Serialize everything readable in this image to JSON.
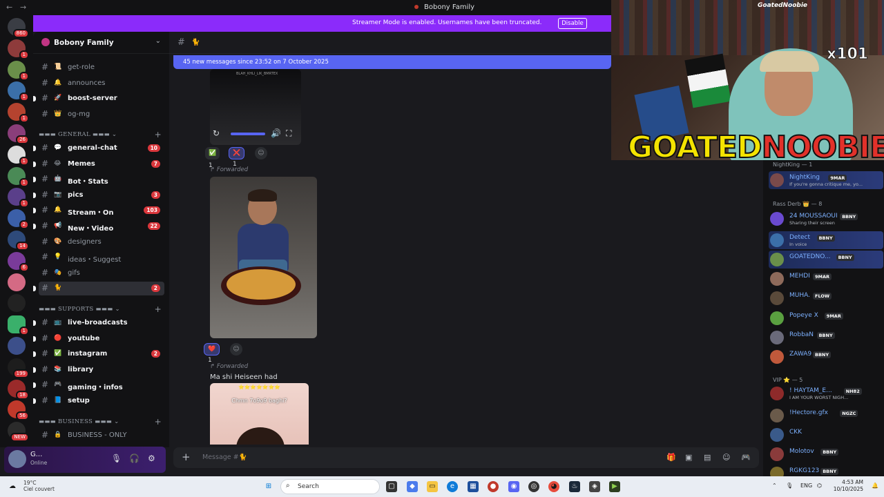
{
  "titlebar": {
    "title": "Bobony Family",
    "back": "←",
    "forward": "→"
  },
  "banner": {
    "text": "Streamer Mode is enabled. Usernames have been truncated.",
    "button": "Disable"
  },
  "guilds": [
    {
      "badge": "860"
    },
    {
      "badge": "1"
    },
    {
      "badge": "1"
    },
    {
      "badge": "1"
    },
    {
      "badge": "1"
    },
    {
      "badge": "26"
    },
    {
      "badge": "1"
    },
    {
      "badge": "1"
    },
    {
      "badge": "1"
    },
    {
      "badge": "2"
    },
    {
      "badge": "14"
    },
    {
      "badge": "6"
    },
    {
      "badge": ""
    },
    {
      "badge": ""
    },
    {
      "badge": "1"
    },
    {
      "badge": ""
    },
    {
      "badge": "199"
    },
    {
      "badge": "18"
    },
    {
      "badge": "56"
    },
    {
      "badge": "NEW"
    }
  ],
  "server": {
    "name": "Bobony Family"
  },
  "channels": [
    {
      "emoji": "📜",
      "label": "get-role",
      "unread": false,
      "count": ""
    },
    {
      "emoji": "🔔",
      "label": "announces",
      "unread": false,
      "count": ""
    },
    {
      "emoji": "🚀",
      "label": "boost-server",
      "unread": true,
      "count": ""
    },
    {
      "emoji": "👑",
      "label": "og-mg",
      "unread": false,
      "count": ""
    }
  ],
  "categories": {
    "general": "GENERAL",
    "supports": "SUPPORTS",
    "business": "BUSINESS"
  },
  "general_channels": [
    {
      "emoji": "💬",
      "label": "general-chat",
      "unread": true,
      "count": "10"
    },
    {
      "emoji": "😂",
      "label": "Memes",
      "unread": true,
      "count": "7"
    },
    {
      "emoji": "🤖",
      "label": "Bot・Stats",
      "unread": true,
      "count": ""
    },
    {
      "emoji": "📷",
      "label": "pics",
      "unread": true,
      "count": "3"
    },
    {
      "emoji": "🔔",
      "label": "Stream・On",
      "unread": true,
      "count": "103"
    },
    {
      "emoji": "📢",
      "label": "New・Video",
      "unread": true,
      "count": "22"
    },
    {
      "emoji": "🎨",
      "label": "designers",
      "unread": false,
      "count": ""
    },
    {
      "emoji": "💡",
      "label": "ideas・Suggest",
      "unread": false,
      "count": ""
    },
    {
      "emoji": "🎭",
      "label": "gifs",
      "unread": false,
      "count": ""
    },
    {
      "emoji": "🐈",
      "label": "",
      "unread": true,
      "count": "2"
    }
  ],
  "support_channels": [
    {
      "emoji": "📺",
      "label": "live-broadcasts",
      "unread": true,
      "count": ""
    },
    {
      "emoji": "🔴",
      "label": "youtube",
      "unread": true,
      "count": ""
    },
    {
      "emoji": "✅",
      "label": "instagram",
      "unread": true,
      "count": "2"
    },
    {
      "emoji": "📚",
      "label": "library",
      "unread": true,
      "count": ""
    },
    {
      "emoji": "🎮",
      "label": "gaming・infos",
      "unread": true,
      "count": ""
    },
    {
      "emoji": "📘",
      "label": "setup",
      "unread": true,
      "count": ""
    }
  ],
  "business_channels": [
    {
      "emoji": "🔒",
      "label": "BUSINESS - ONLY",
      "unread": false,
      "count": ""
    }
  ],
  "user": {
    "name": "G...",
    "status": "Online"
  },
  "channel_header": {
    "emoji": "🐈"
  },
  "new_messages": "45 new messages since 23:52 on 7 October 2025",
  "video": {
    "watermark": "BLAH_KHLI_LIK_BMRTEX"
  },
  "reactions1": [
    {
      "emoji": "✅",
      "count": "1"
    },
    {
      "emoji": "❌",
      "count": "1"
    }
  ],
  "reactions2": [
    {
      "emoji": "❤️",
      "count": "1"
    }
  ],
  "forwarded_label": "Forwarded",
  "message_text": "Ma shi Heiseen had",
  "meme": {
    "caption": "Chmn 7o9o9 baghi?",
    "stars": "⭐⭐⭐⭐⭐⭐⭐"
  },
  "composer": {
    "placeholder": "Message #🐈"
  },
  "stream": {
    "handle": "GoatedNoobie",
    "brand_a": "GOATED",
    "brand_b": "NOOBIE",
    "multiplier": "x101"
  },
  "member_groups": {
    "nightking": "NightKing — 1",
    "rass": "Rass Derb 👑 — 8",
    "vip": "VIP ⭐ — 5"
  },
  "members": [
    {
      "name": "NightKing",
      "tag": "9MAR",
      "sub": "If you're gonna critique me, yo..."
    },
    {
      "name": "24 MOUSSAOUI",
      "tag": "BBNY",
      "sub": "Sharing their screen"
    },
    {
      "name": "Detect",
      "tag": "BBNY",
      "sub": "In voice"
    },
    {
      "name": "GOATEDNO...",
      "tag": "BBNY",
      "sub": ""
    },
    {
      "name": "MEHDI",
      "tag": "9MAR",
      "sub": ""
    },
    {
      "name": "MUHA.",
      "tag": "FLOW",
      "sub": ""
    },
    {
      "name": "Popeye X",
      "tag": "9MAR",
      "sub": ""
    },
    {
      "name": "RobbaN",
      "tag": "BBNY",
      "sub": ""
    },
    {
      "name": "ZAWA9",
      "tag": "BBNY",
      "sub": ""
    },
    {
      "name": "! HAYTAM_E...",
      "tag": "NH82",
      "sub": "I AM YOUR WORST NIGH..."
    },
    {
      "name": "!Hectore.gfx",
      "tag": "NGZC",
      "sub": ""
    },
    {
      "name": "CKK",
      "tag": "",
      "sub": ""
    },
    {
      "name": "Molotov",
      "tag": "BBNY",
      "sub": ""
    },
    {
      "name": "RGKG123",
      "tag": "BBNY",
      "sub": ""
    }
  ],
  "taskbar": {
    "weather_temp": "19°C",
    "weather_desc": "Ciel couvert",
    "search": "Search",
    "lang": "ENG",
    "time": "4:53 AM",
    "date": "10/10/2025"
  },
  "colors": {
    "accent": "#5865f2",
    "banner": "#8b2bfa",
    "badge": "#da373c"
  }
}
